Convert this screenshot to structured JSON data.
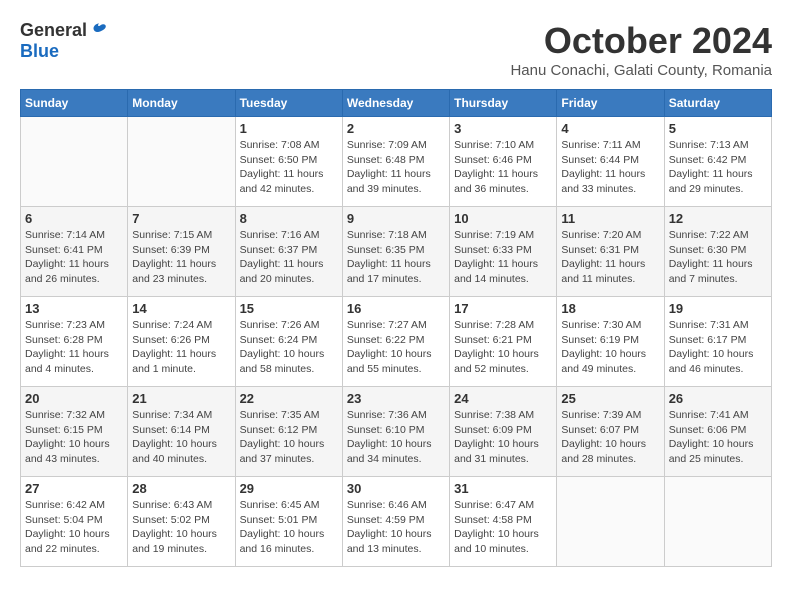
{
  "header": {
    "logo_general": "General",
    "logo_blue": "Blue",
    "month_title": "October 2024",
    "location": "Hanu Conachi, Galati County, Romania"
  },
  "weekdays": [
    "Sunday",
    "Monday",
    "Tuesday",
    "Wednesday",
    "Thursday",
    "Friday",
    "Saturday"
  ],
  "weeks": [
    [
      {
        "day": "",
        "sunrise": "",
        "sunset": "",
        "daylight": ""
      },
      {
        "day": "",
        "sunrise": "",
        "sunset": "",
        "daylight": ""
      },
      {
        "day": "1",
        "sunrise": "Sunrise: 7:08 AM",
        "sunset": "Sunset: 6:50 PM",
        "daylight": "Daylight: 11 hours and 42 minutes."
      },
      {
        "day": "2",
        "sunrise": "Sunrise: 7:09 AM",
        "sunset": "Sunset: 6:48 PM",
        "daylight": "Daylight: 11 hours and 39 minutes."
      },
      {
        "day": "3",
        "sunrise": "Sunrise: 7:10 AM",
        "sunset": "Sunset: 6:46 PM",
        "daylight": "Daylight: 11 hours and 36 minutes."
      },
      {
        "day": "4",
        "sunrise": "Sunrise: 7:11 AM",
        "sunset": "Sunset: 6:44 PM",
        "daylight": "Daylight: 11 hours and 33 minutes."
      },
      {
        "day": "5",
        "sunrise": "Sunrise: 7:13 AM",
        "sunset": "Sunset: 6:42 PM",
        "daylight": "Daylight: 11 hours and 29 minutes."
      }
    ],
    [
      {
        "day": "6",
        "sunrise": "Sunrise: 7:14 AM",
        "sunset": "Sunset: 6:41 PM",
        "daylight": "Daylight: 11 hours and 26 minutes."
      },
      {
        "day": "7",
        "sunrise": "Sunrise: 7:15 AM",
        "sunset": "Sunset: 6:39 PM",
        "daylight": "Daylight: 11 hours and 23 minutes."
      },
      {
        "day": "8",
        "sunrise": "Sunrise: 7:16 AM",
        "sunset": "Sunset: 6:37 PM",
        "daylight": "Daylight: 11 hours and 20 minutes."
      },
      {
        "day": "9",
        "sunrise": "Sunrise: 7:18 AM",
        "sunset": "Sunset: 6:35 PM",
        "daylight": "Daylight: 11 hours and 17 minutes."
      },
      {
        "day": "10",
        "sunrise": "Sunrise: 7:19 AM",
        "sunset": "Sunset: 6:33 PM",
        "daylight": "Daylight: 11 hours and 14 minutes."
      },
      {
        "day": "11",
        "sunrise": "Sunrise: 7:20 AM",
        "sunset": "Sunset: 6:31 PM",
        "daylight": "Daylight: 11 hours and 11 minutes."
      },
      {
        "day": "12",
        "sunrise": "Sunrise: 7:22 AM",
        "sunset": "Sunset: 6:30 PM",
        "daylight": "Daylight: 11 hours and 7 minutes."
      }
    ],
    [
      {
        "day": "13",
        "sunrise": "Sunrise: 7:23 AM",
        "sunset": "Sunset: 6:28 PM",
        "daylight": "Daylight: 11 hours and 4 minutes."
      },
      {
        "day": "14",
        "sunrise": "Sunrise: 7:24 AM",
        "sunset": "Sunset: 6:26 PM",
        "daylight": "Daylight: 11 hours and 1 minute."
      },
      {
        "day": "15",
        "sunrise": "Sunrise: 7:26 AM",
        "sunset": "Sunset: 6:24 PM",
        "daylight": "Daylight: 10 hours and 58 minutes."
      },
      {
        "day": "16",
        "sunrise": "Sunrise: 7:27 AM",
        "sunset": "Sunset: 6:22 PM",
        "daylight": "Daylight: 10 hours and 55 minutes."
      },
      {
        "day": "17",
        "sunrise": "Sunrise: 7:28 AM",
        "sunset": "Sunset: 6:21 PM",
        "daylight": "Daylight: 10 hours and 52 minutes."
      },
      {
        "day": "18",
        "sunrise": "Sunrise: 7:30 AM",
        "sunset": "Sunset: 6:19 PM",
        "daylight": "Daylight: 10 hours and 49 minutes."
      },
      {
        "day": "19",
        "sunrise": "Sunrise: 7:31 AM",
        "sunset": "Sunset: 6:17 PM",
        "daylight": "Daylight: 10 hours and 46 minutes."
      }
    ],
    [
      {
        "day": "20",
        "sunrise": "Sunrise: 7:32 AM",
        "sunset": "Sunset: 6:15 PM",
        "daylight": "Daylight: 10 hours and 43 minutes."
      },
      {
        "day": "21",
        "sunrise": "Sunrise: 7:34 AM",
        "sunset": "Sunset: 6:14 PM",
        "daylight": "Daylight: 10 hours and 40 minutes."
      },
      {
        "day": "22",
        "sunrise": "Sunrise: 7:35 AM",
        "sunset": "Sunset: 6:12 PM",
        "daylight": "Daylight: 10 hours and 37 minutes."
      },
      {
        "day": "23",
        "sunrise": "Sunrise: 7:36 AM",
        "sunset": "Sunset: 6:10 PM",
        "daylight": "Daylight: 10 hours and 34 minutes."
      },
      {
        "day": "24",
        "sunrise": "Sunrise: 7:38 AM",
        "sunset": "Sunset: 6:09 PM",
        "daylight": "Daylight: 10 hours and 31 minutes."
      },
      {
        "day": "25",
        "sunrise": "Sunrise: 7:39 AM",
        "sunset": "Sunset: 6:07 PM",
        "daylight": "Daylight: 10 hours and 28 minutes."
      },
      {
        "day": "26",
        "sunrise": "Sunrise: 7:41 AM",
        "sunset": "Sunset: 6:06 PM",
        "daylight": "Daylight: 10 hours and 25 minutes."
      }
    ],
    [
      {
        "day": "27",
        "sunrise": "Sunrise: 6:42 AM",
        "sunset": "Sunset: 5:04 PM",
        "daylight": "Daylight: 10 hours and 22 minutes."
      },
      {
        "day": "28",
        "sunrise": "Sunrise: 6:43 AM",
        "sunset": "Sunset: 5:02 PM",
        "daylight": "Daylight: 10 hours and 19 minutes."
      },
      {
        "day": "29",
        "sunrise": "Sunrise: 6:45 AM",
        "sunset": "Sunset: 5:01 PM",
        "daylight": "Daylight: 10 hours and 16 minutes."
      },
      {
        "day": "30",
        "sunrise": "Sunrise: 6:46 AM",
        "sunset": "Sunset: 4:59 PM",
        "daylight": "Daylight: 10 hours and 13 minutes."
      },
      {
        "day": "31",
        "sunrise": "Sunrise: 6:47 AM",
        "sunset": "Sunset: 4:58 PM",
        "daylight": "Daylight: 10 hours and 10 minutes."
      },
      {
        "day": "",
        "sunrise": "",
        "sunset": "",
        "daylight": ""
      },
      {
        "day": "",
        "sunrise": "",
        "sunset": "",
        "daylight": ""
      }
    ]
  ]
}
